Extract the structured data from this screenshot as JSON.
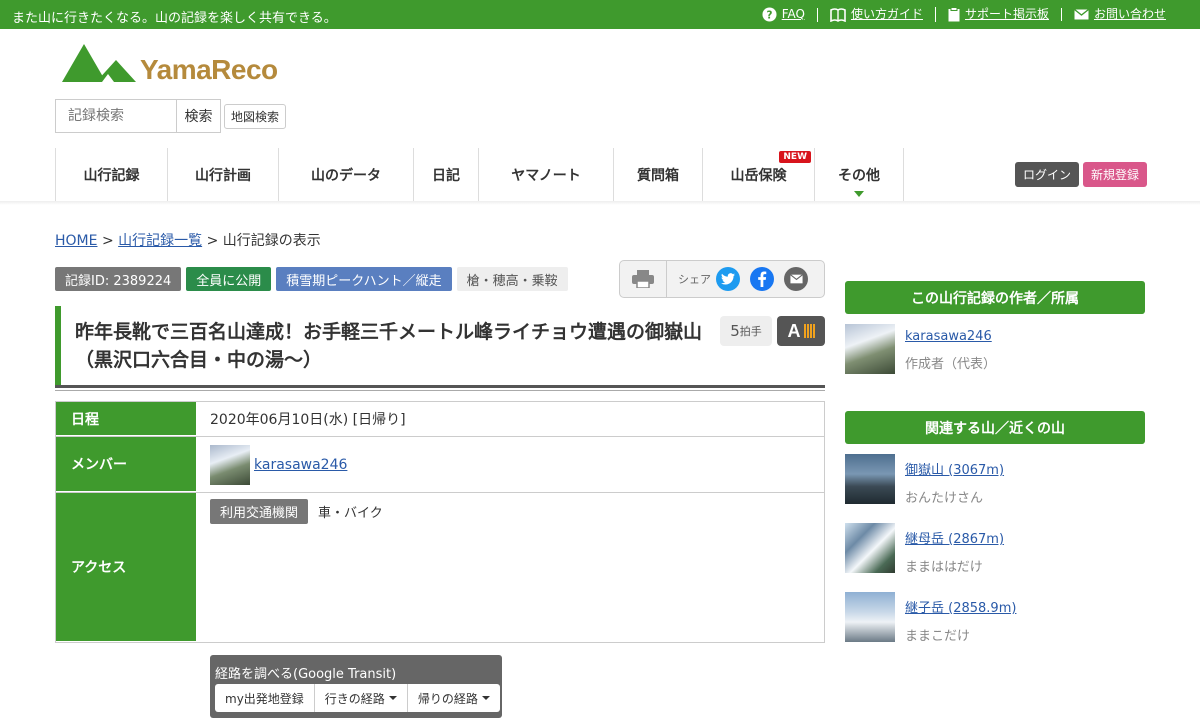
{
  "topbar": {
    "tagline": "また山に行きたくなる。山の記録を楽しく共有できる。",
    "links": [
      {
        "label": "FAQ",
        "icon": "question-circle-icon"
      },
      {
        "label": "使い方ガイド",
        "icon": "book-icon"
      },
      {
        "label": "サポート掲示板",
        "icon": "clipboard-icon"
      },
      {
        "label": "お問い合わせ",
        "icon": "envelope-icon"
      }
    ]
  },
  "logo": {
    "text": "YamaReco"
  },
  "search": {
    "placeholder": "記録検索",
    "button": "検索",
    "map_button": "地図検索"
  },
  "nav": {
    "items": [
      "山行記録",
      "山行計画",
      "山のデータ",
      "日記",
      "ヤマノート",
      "質問箱",
      "山岳保険",
      "その他"
    ],
    "new_badge": "NEW"
  },
  "auth": {
    "login": "ログイン",
    "signup": "新規登録"
  },
  "breadcrumb": {
    "home": "HOME",
    "list": "山行記録一覧",
    "sep": ">",
    "current": "山行記録の表示"
  },
  "tags": {
    "record_id": "記録ID: 2389224",
    "visibility": "全員に公開",
    "category": "積雪期ピークハント／縦走",
    "area": "槍・穂高・乗鞍"
  },
  "share": {
    "label": "シェア"
  },
  "record": {
    "title": "昨年長靴で三百名山達成！お手軽三千メートル峰ライチョウ遭遇の御嶽山（黒沢口六合目・中の湯～）",
    "clap_count": "5",
    "clap_unit": "拍手",
    "grade": "A"
  },
  "info": {
    "date_label": "日程",
    "date_value": "2020年06月10日(水) [日帰り]",
    "member_label": "メンバー",
    "member_name": "karasawa246",
    "access_label": "アクセス",
    "transport_badge": "利用交通機関",
    "transport_value": "車・バイク",
    "transit_title": "経路を調べる(Google Transit)",
    "transit_buttons": [
      "my出発地登録",
      "行きの経路",
      "帰りの経路"
    ]
  },
  "sidebar": {
    "author_header": "この山行記録の作者／所属",
    "author_name": "karasawa246",
    "author_role": "作成者（代表）",
    "related_header": "関連する山／近くの山",
    "mountains": [
      {
        "name": "御嶽山 (3067m)",
        "reading": "おんたけさん"
      },
      {
        "name": "継母岳 (2867m)",
        "reading": "ままははだけ"
      },
      {
        "name": "継子岳 (2858.9m)",
        "reading": "ままこだけ"
      }
    ]
  },
  "colors": {
    "brand_green": "#3f9a2d",
    "logo_gold": "#b58a3c",
    "signup_pink": "#d9578a",
    "login_gray": "#555555",
    "tag_blue": "#5a7fc0",
    "tag_green": "#2b8c4a"
  }
}
